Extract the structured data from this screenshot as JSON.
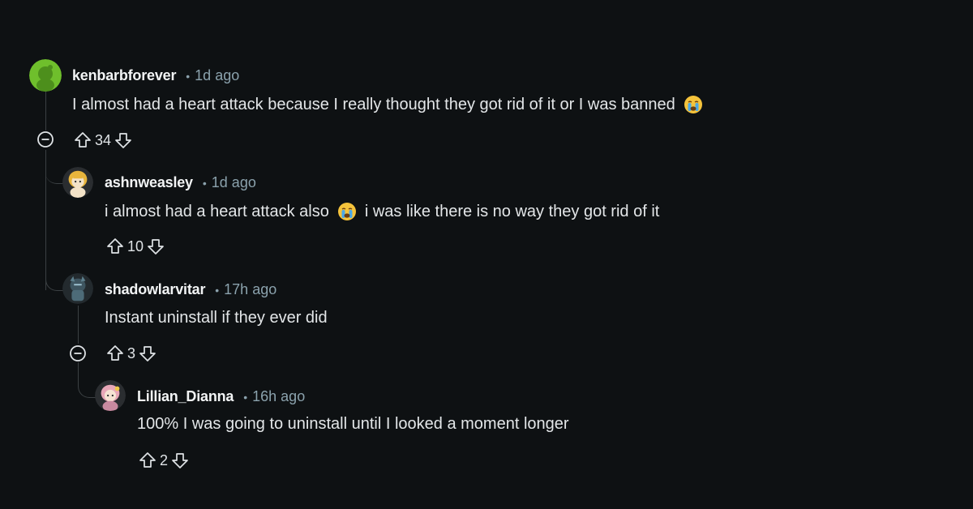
{
  "comments": [
    {
      "username": "kenbarbforever",
      "separator": "•",
      "time": "1d ago",
      "body": "I almost had a heart attack because I really thought they got rid of it or I was banned",
      "emoji": "crying-face",
      "score": "34",
      "avatar": "green-snoo-avatar"
    },
    {
      "username": "ashnweasley",
      "separator": "•",
      "time": "1d ago",
      "body_before": "i almost had a heart attack also",
      "emoji": "crying-face",
      "body_after": "i was like there is no way they got rid of it",
      "score": "10",
      "avatar": "blonde-snoo-avatar"
    },
    {
      "username": "shadowlarvitar",
      "separator": "•",
      "time": "17h ago",
      "body": "Instant uninstall if they ever did",
      "score": "3",
      "avatar": "dark-snoo-avatar"
    },
    {
      "username": "Lillian_Dianna",
      "separator": "•",
      "time": "16h ago",
      "body": "100% I was going to uninstall until I looked a moment longer",
      "score": "2",
      "avatar": "pink-snoo-avatar"
    }
  ],
  "colors": {
    "background": "#0e1113",
    "thread_line": "#3b4043",
    "meta_text": "#8ba2ad",
    "username": "#f2f4f5",
    "body_text": "#e3e6e8"
  },
  "icons": {
    "upvote": "upvote-arrow-icon",
    "downvote": "downvote-arrow-icon",
    "collapse": "collapse-minus-icon"
  }
}
